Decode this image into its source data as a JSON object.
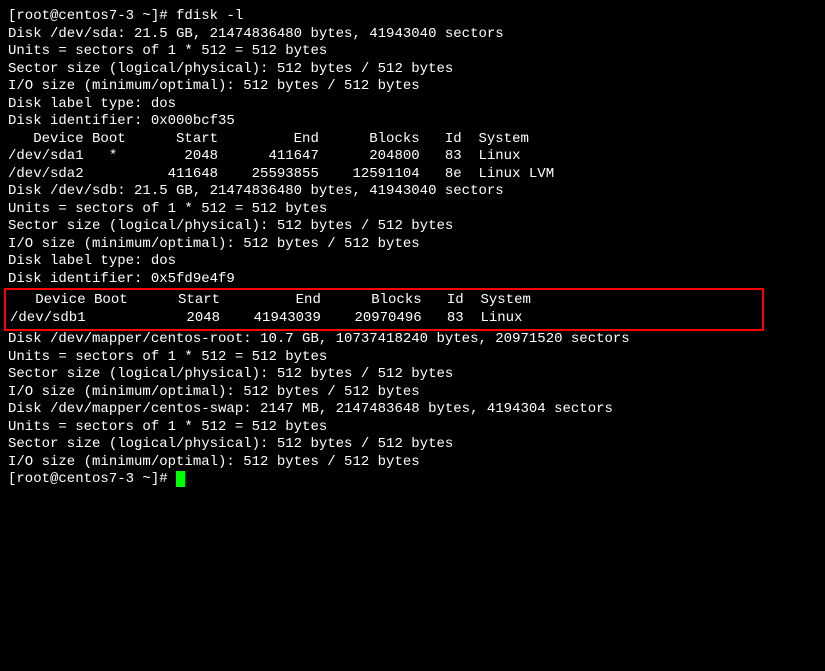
{
  "prompt1": "[root@centos7-3 ~]# ",
  "command": "fdisk -l",
  "blank": "",
  "sda": {
    "header": "Disk /dev/sda: 21.5 GB, 21474836480 bytes, 41943040 sectors",
    "units": "Units = sectors of 1 * 512 = 512 bytes",
    "sector": "Sector size (logical/physical): 512 bytes / 512 bytes",
    "io": "I/O size (minimum/optimal): 512 bytes / 512 bytes",
    "label": "Disk label type: dos",
    "ident": "Disk identifier: 0x000bcf35",
    "thead": "   Device Boot      Start         End      Blocks   Id  System",
    "row1": "/dev/sda1   *        2048      411647      204800   83  Linux",
    "row2": "/dev/sda2          411648    25593855    12591104   8e  Linux LVM"
  },
  "sdb": {
    "header": "Disk /dev/sdb: 21.5 GB, 21474836480 bytes, 41943040 sectors",
    "units": "Units = sectors of 1 * 512 = 512 bytes",
    "sector": "Sector size (logical/physical): 512 bytes / 512 bytes",
    "io": "I/O size (minimum/optimal): 512 bytes / 512 bytes",
    "label": "Disk label type: dos",
    "ident": "Disk identifier: 0x5fd9e4f9",
    "thead": "   Device Boot      Start         End      Blocks   Id  System                           ",
    "row1": "/dev/sdb1            2048    41943039    20970496   83  Linux                            "
  },
  "centos_root": {
    "header": "Disk /dev/mapper/centos-root: 10.7 GB, 10737418240 bytes, 20971520 sectors",
    "units": "Units = sectors of 1 * 512 = 512 bytes",
    "sector": "Sector size (logical/physical): 512 bytes / 512 bytes",
    "io": "I/O size (minimum/optimal): 512 bytes / 512 bytes"
  },
  "centos_swap": {
    "header": "Disk /dev/mapper/centos-swap: 2147 MB, 2147483648 bytes, 4194304 sectors",
    "units": "Units = sectors of 1 * 512 = 512 bytes",
    "sector": "Sector size (logical/physical): 512 bytes / 512 bytes",
    "io": "I/O size (minimum/optimal): 512 bytes / 512 bytes"
  },
  "prompt2": "[root@centos7-3 ~]# "
}
